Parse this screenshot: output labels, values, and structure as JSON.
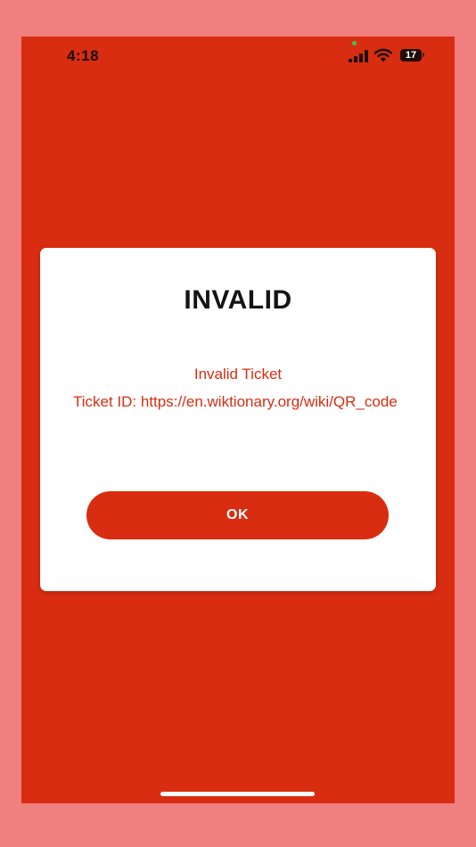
{
  "status_bar": {
    "time": "4:18",
    "battery_level": "17",
    "icons": [
      "signal-icon",
      "wifi-icon",
      "battery-icon"
    ]
  },
  "dialog": {
    "title": "INVALID",
    "subtitle": "Invalid Ticket",
    "message": "Ticket ID: https://en.wiktionary.org/wiki/QR_code",
    "ok_label": "OK"
  },
  "colors": {
    "accent": "#d82d10",
    "background_outer": "#f08080",
    "dialog_background": "#ffffff",
    "title_text": "#141414"
  }
}
